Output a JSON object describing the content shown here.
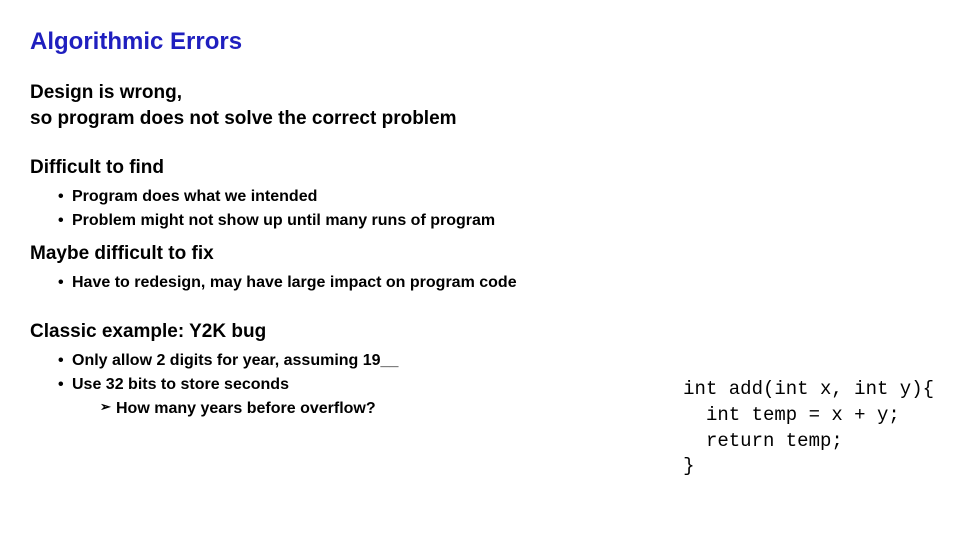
{
  "title": "Algorithmic Errors",
  "intro_line1": "Design is wrong,",
  "intro_line2": "so program does not solve the correct problem",
  "section1": {
    "heading": "Difficult to find",
    "bullets": [
      "Program does what we intended",
      "Problem might not show up until many runs of program"
    ]
  },
  "section2": {
    "heading": "Maybe difficult to fix",
    "bullets": [
      "Have to redesign, may have large impact on program code"
    ]
  },
  "section3": {
    "heading": "Classic example: Y2K bug",
    "bullets": [
      "Only allow 2 digits for year, assuming 19__",
      "Use 32 bits to store seconds"
    ],
    "sub": [
      "How many years before overflow?"
    ]
  },
  "code": "int add(int x, int y){\n  int temp = x + y;\n  return temp;\n}"
}
